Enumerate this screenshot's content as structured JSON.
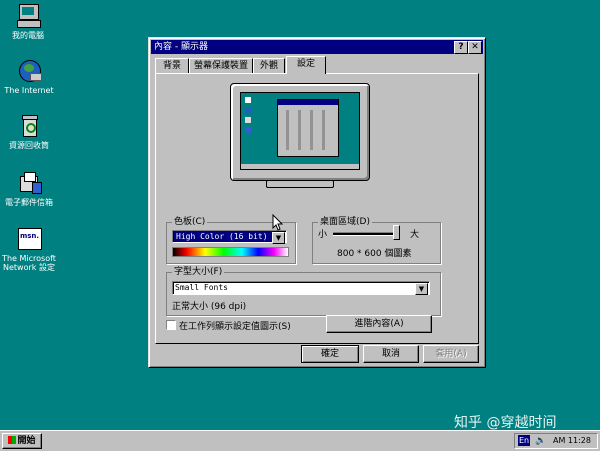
{
  "desktop": {
    "icons": [
      {
        "label": "我的電腦"
      },
      {
        "label": "The Internet"
      },
      {
        "label": "資源回收筒"
      },
      {
        "label": "電子郵件信箱"
      },
      {
        "label_line1": "The Microsoft",
        "label_line2": "Network 設定",
        "badge": "msn."
      }
    ]
  },
  "window": {
    "title": "內容 - 顯示器",
    "help_btn": "?",
    "close_btn": "✕",
    "tabs": [
      {
        "label": "背景"
      },
      {
        "label": "螢幕保護裝置"
      },
      {
        "label": "外觀"
      },
      {
        "label": "設定"
      }
    ],
    "color_palette": {
      "label": "色板(C)",
      "selected": "High Color (16 bit)"
    },
    "desktop_area": {
      "label": "桌面區域(D)",
      "min_label": "小",
      "max_label": "大",
      "resolution": "800 * 600 個圖素"
    },
    "font_size": {
      "label": "字型大小(F)",
      "selected": "Small Fonts",
      "note": "正常大小 (96 dpi)"
    },
    "taskbar_checkbox_label": "在工作列顯示設定值圖示(S)",
    "advanced_button": "進階內容(A)",
    "ok_button": "確定",
    "cancel_button": "取消",
    "apply_button": "套用(A)"
  },
  "taskbar": {
    "start_label": "開始",
    "lang": "En",
    "clock": "AM 11:28"
  },
  "watermark": "知乎 @穿越时间",
  "colors": {
    "desktop": "#008080",
    "titlebar": "#000080",
    "face": "#c0c0c0",
    "selection": "#000080"
  }
}
